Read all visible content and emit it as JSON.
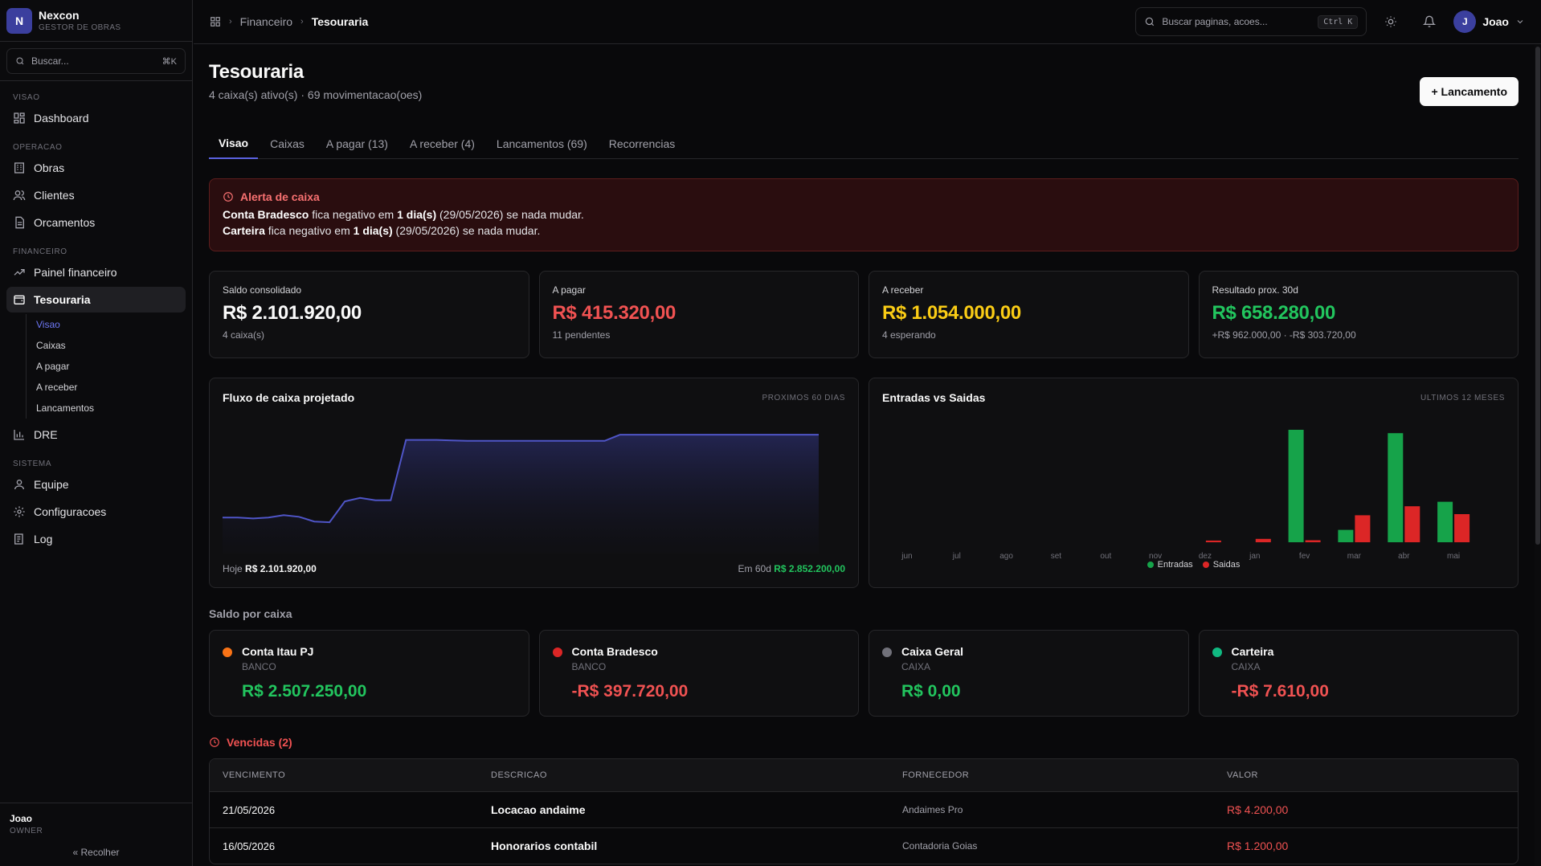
{
  "brand": {
    "logo_letter": "N",
    "name": "Nexcon",
    "subtitle": "GESTOR DE OBRAS"
  },
  "sidebar": {
    "search_placeholder": "Buscar...",
    "search_shortcut": "⌘K",
    "groups": [
      {
        "label": "VISAO",
        "items": [
          {
            "label": "Dashboard",
            "icon": "dashboard-icon"
          }
        ]
      },
      {
        "label": "OPERACAO",
        "items": [
          {
            "label": "Obras",
            "icon": "building-icon"
          },
          {
            "label": "Clientes",
            "icon": "users-icon"
          },
          {
            "label": "Orcamentos",
            "icon": "document-icon"
          }
        ]
      },
      {
        "label": "FINANCEIRO",
        "items": [
          {
            "label": "Painel financeiro",
            "icon": "trending-icon"
          },
          {
            "label": "Tesouraria",
            "icon": "wallet-icon"
          },
          {
            "label": "DRE",
            "icon": "bar-chart-icon"
          }
        ]
      },
      {
        "label": "SISTEMA",
        "items": [
          {
            "label": "Equipe",
            "icon": "user-icon"
          },
          {
            "label": "Configuracoes",
            "icon": "gear-icon"
          },
          {
            "label": "Log",
            "icon": "log-icon"
          }
        ]
      }
    ],
    "subnav": [
      "Visao",
      "Caixas",
      "A pagar",
      "A receber",
      "Lancamentos"
    ],
    "footer": {
      "user": "Joao",
      "role": "OWNER",
      "collapse": "Recolher"
    }
  },
  "topbar": {
    "breadcrumb": [
      "Financeiro",
      "Tesouraria"
    ],
    "search_placeholder": "Buscar paginas, acoes...",
    "search_shortcut": "Ctrl K",
    "avatar_letter": "J",
    "user_name": "Joao"
  },
  "page": {
    "title": "Tesouraria",
    "subtitle": "4 caixa(s) ativo(s) · 69 movimentacao(oes)",
    "new_button": "+ Lancamento",
    "tabs": [
      "Visao",
      "Caixas",
      "A pagar (13)",
      "A receber (4)",
      "Lancamentos (69)",
      "Recorrencias"
    ]
  },
  "alert": {
    "title": "Alerta de caixa",
    "lines": [
      {
        "account": "Conta Bradesco",
        "mid": " fica negativo em ",
        "days": "1 dia(s)",
        "rest": " (29/05/2026) se nada mudar."
      },
      {
        "account": "Carteira",
        "mid": " fica negativo em ",
        "days": "1 dia(s)",
        "rest": " (29/05/2026) se nada mudar."
      }
    ]
  },
  "kpis": [
    {
      "label": "Saldo consolidado",
      "value": "R$ 2.101.920,00",
      "sub": "4 caixa(s)",
      "color": "#fafafa"
    },
    {
      "label": "A pagar",
      "value": "R$ 415.320,00",
      "sub": "11 pendentes",
      "color": "#f05252"
    },
    {
      "label": "A receber",
      "value": "R$ 1.054.000,00",
      "sub": "4 esperando",
      "color": "#facc15"
    },
    {
      "label": "Resultado prox. 30d",
      "value": "R$ 658.280,00",
      "sub": "+R$ 962.000,00 · -R$ 303.720,00",
      "color": "#22c55e"
    }
  ],
  "flow_chart": {
    "title": "Fluxo de caixa projetado",
    "tag": "PROXIMOS 60 DIAS",
    "foot_left_label": "Hoje",
    "foot_left_value": "R$ 2.101.920,00",
    "foot_right_label": "Em 60d",
    "foot_right_value": "R$ 2.852.200,00"
  },
  "bars_chart": {
    "title": "Entradas vs Saidas",
    "tag": "ULTIMOS 12 MESES",
    "legend": [
      "Entradas",
      "Saidas"
    ]
  },
  "chart_data": [
    {
      "type": "area",
      "title": "Fluxo de caixa projetado",
      "x_label_start": "Hoje",
      "x_label_end": "Em 60d",
      "start_value": 2101920,
      "end_value": 2852200,
      "series": [
        {
          "name": "Saldo projetado",
          "values": [
            2101920,
            2101920,
            2098000,
            2101920,
            2112000,
            2105000,
            2085000,
            2082000,
            2170000,
            2185000,
            2175000,
            2175000,
            2430000,
            2430000,
            2430000,
            2428000,
            2426000,
            2426000,
            2426000,
            2426000,
            2426000,
            2426000,
            2426000,
            2426000,
            2426000,
            2426000,
            2452200,
            2452200,
            2452200,
            2452200,
            2452200,
            2452200,
            2452200,
            2452200,
            2452200,
            2452200,
            2452200,
            2452200,
            2452200,
            2452200
          ]
        }
      ],
      "color": "#4f55c7"
    },
    {
      "type": "bar",
      "title": "Entradas vs Saidas",
      "categories": [
        "jun",
        "jul",
        "ago",
        "set",
        "out",
        "nov",
        "dez",
        "jan",
        "fev",
        "mar",
        "abr",
        "mai"
      ],
      "series": [
        {
          "name": "Entradas",
          "color": "#16a34a",
          "values": [
            0,
            0,
            0,
            0,
            0,
            0,
            0,
            0,
            1000000,
            110000,
            970000,
            360000
          ]
        },
        {
          "name": "Saidas",
          "color": "#dc2626",
          "values": [
            0,
            0,
            0,
            0,
            0,
            0,
            15000,
            30000,
            18000,
            240000,
            320000,
            250000
          ]
        }
      ],
      "ylim": [
        0,
        1000000
      ]
    }
  ],
  "accounts_section": "Saldo por caixa",
  "accounts": [
    {
      "name": "Conta Itau PJ",
      "type": "BANCO",
      "balance": "R$ 2.507.250,00",
      "dot": "#f97316",
      "color": "#22c55e"
    },
    {
      "name": "Conta Bradesco",
      "type": "BANCO",
      "balance": "-R$ 397.720,00",
      "dot": "#dc2626",
      "color": "#f05252"
    },
    {
      "name": "Caixa Geral",
      "type": "CAIXA",
      "balance": "R$ 0,00",
      "dot": "#71717a",
      "color": "#22c55e"
    },
    {
      "name": "Carteira",
      "type": "CAIXA",
      "balance": "-R$ 7.610,00",
      "dot": "#10b981",
      "color": "#f05252"
    }
  ],
  "overdue": {
    "title": "Vencidas (2)",
    "headers": [
      "VENCIMENTO",
      "DESCRICAO",
      "FORNECEDOR",
      "VALOR"
    ],
    "rows": [
      {
        "due": "21/05/2026",
        "desc": "Locacao andaime",
        "supplier": "Andaimes Pro",
        "value": "R$ 4.200,00"
      },
      {
        "due": "16/05/2026",
        "desc": "Honorarios contabil",
        "supplier": "Contadoria Goias",
        "value": "R$ 1.200,00"
      }
    ]
  }
}
